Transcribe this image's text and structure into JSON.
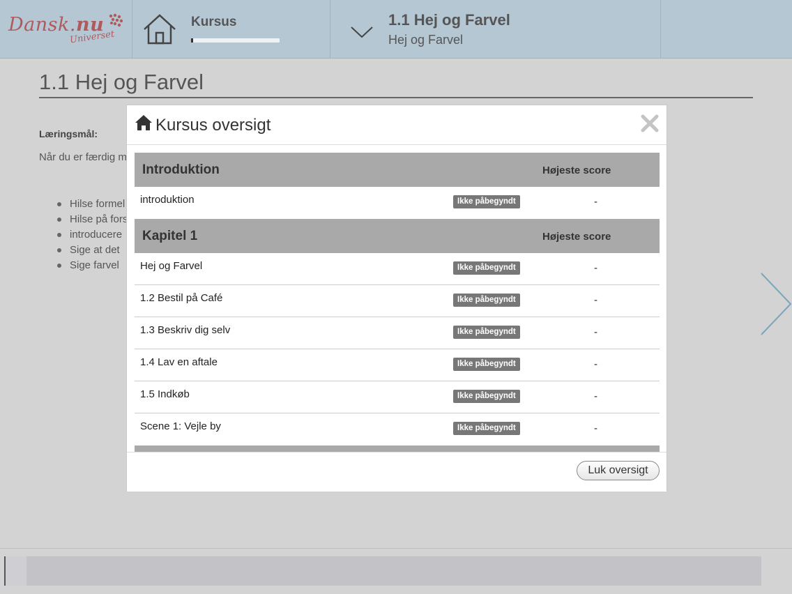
{
  "app": {
    "logo_main": "Dansk",
    "logo_dot": ".",
    "logo_nu": "nu",
    "logo_sub": "Universet",
    "brand_color": "#b05a5e"
  },
  "header": {
    "course_label": "Kursus",
    "course_progress_fraction": 0.02,
    "lesson_title": "1.1 Hej og Farvel",
    "lesson_subtitle": "Hej og Farvel"
  },
  "page": {
    "title": "1.1 Hej og Farvel",
    "goal_label": "Læringsmål:",
    "goal_intro": "Når du er færdig m",
    "goals": [
      "Hilse formel",
      "Hilse på fors",
      "introducere",
      "Sige at det",
      "Sige farvel"
    ]
  },
  "modal": {
    "title": "Kursus oversigt",
    "close_button": "Luk oversigt",
    "sections": [
      {
        "name": "Introduktion",
        "score_header": "Højeste score",
        "rows": [
          {
            "label": "introduktion",
            "status": "Ikke påbegyndt",
            "score": "-"
          }
        ]
      },
      {
        "name": "Kapitel 1",
        "score_header": "Højeste score",
        "rows": [
          {
            "label": "Hej og Farvel",
            "status": "Ikke påbegyndt",
            "score": "-"
          },
          {
            "label": "1.2 Bestil på Café",
            "status": "Ikke påbegyndt",
            "score": "-"
          },
          {
            "label": "1.3 Beskriv dig selv",
            "status": "Ikke påbegyndt",
            "score": "-"
          },
          {
            "label": "1.4 Lav en aftale",
            "status": "Ikke påbegyndt",
            "score": "-"
          },
          {
            "label": "1.5 Indkøb",
            "status": "Ikke påbegyndt",
            "score": "-"
          },
          {
            "label": "Scene 1: Vejle by",
            "status": "Ikke påbegyndt",
            "score": "-"
          }
        ]
      }
    ]
  }
}
